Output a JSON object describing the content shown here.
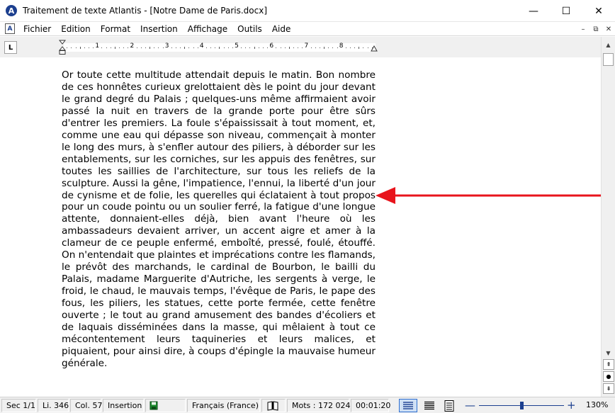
{
  "window": {
    "app_icon_letter": "A",
    "title": "Traitement de texte Atlantis - [Notre Dame de Paris.docx]",
    "minimize": "—",
    "maximize": "☐",
    "close": "✕"
  },
  "menubar": {
    "doc_icon_letter": "A",
    "items": [
      "Fichier",
      "Edition",
      "Format",
      "Insertion",
      "Affichage",
      "Outils",
      "Aide"
    ],
    "mdi_minimize": "–",
    "mdi_restore": "⧉",
    "mdi_close": "✕"
  },
  "ruler": {
    "tab_type": "L",
    "numbers": [
      "1",
      "2",
      "3",
      "4",
      "5",
      "6",
      "7",
      "8"
    ]
  },
  "document": {
    "paragraph": "Or toute cette multitude attendait depuis le matin. Bon nombre de ces honnêtes curieux grelottaient dès le point du jour devant le grand degré du Palais ; quelques-uns même affirmaient avoir passé la nuit en travers de la grande porte pour être sûrs d'entrer les premiers. La foule s'épaississait à tout moment, et, comme une eau qui dépasse son niveau, commençait à monter le long des murs, à s'enfler autour des piliers, à déborder sur les entablements, sur les corniches, sur les appuis des fenêtres, sur toutes les saillies de l'architecture, sur tous les reliefs de la sculpture. Aussi la gêne, l'impatience, l'ennui, la liberté d'un jour de cynisme et de folie, les querelles qui éclataient à tout propos pour un coude pointu ou un soulier ferré, la fatigue d'une longue attente, donnaient-elles déjà, bien avant l'heure où les ambassadeurs devaient arriver, un accent aigre et amer à la clameur de ce peuple enfermé, emboîté, pressé, foulé, étouffé. On n'entendait que plaintes et imprécations contre les flamands, le prévôt des marchands, le cardinal de Bourbon, le bailli du Palais, madame Marguerite d'Autriche, les sergents à verge, le froid, le chaud, le mauvais temps, l'évêque de Paris, le pape des fous, les piliers, les statues, cette porte fermée, cette fenêtre ouverte ; le tout au grand amusement des bandes d'écoliers et de laquais disséminées dans la masse, qui mêlaient à tout ce mécontentement leurs taquineries et leurs malices, et piquaient, pour ainsi dire, à coups d'épingle la mauvaise humeur générale."
  },
  "scrollbar": {
    "up": "▲",
    "down": "▼",
    "prev_page": "⇞",
    "browse": "●",
    "next_page": "⇟"
  },
  "statusbar": {
    "section": "Sec 1/1",
    "line": "Li. 346",
    "column": "Col. 57",
    "mode": "Insertion",
    "language": "Français (France)",
    "words": "Mots : 172 024",
    "time": "00:01:20",
    "zoom_minus": "—",
    "zoom_plus": "+",
    "zoom": "130%",
    "zoom_level_fraction": 0.5
  },
  "colors": {
    "accent": "#1c3f8f",
    "annotation_arrow": "#e8141c",
    "active_view_bg": "#cfe0f5"
  }
}
